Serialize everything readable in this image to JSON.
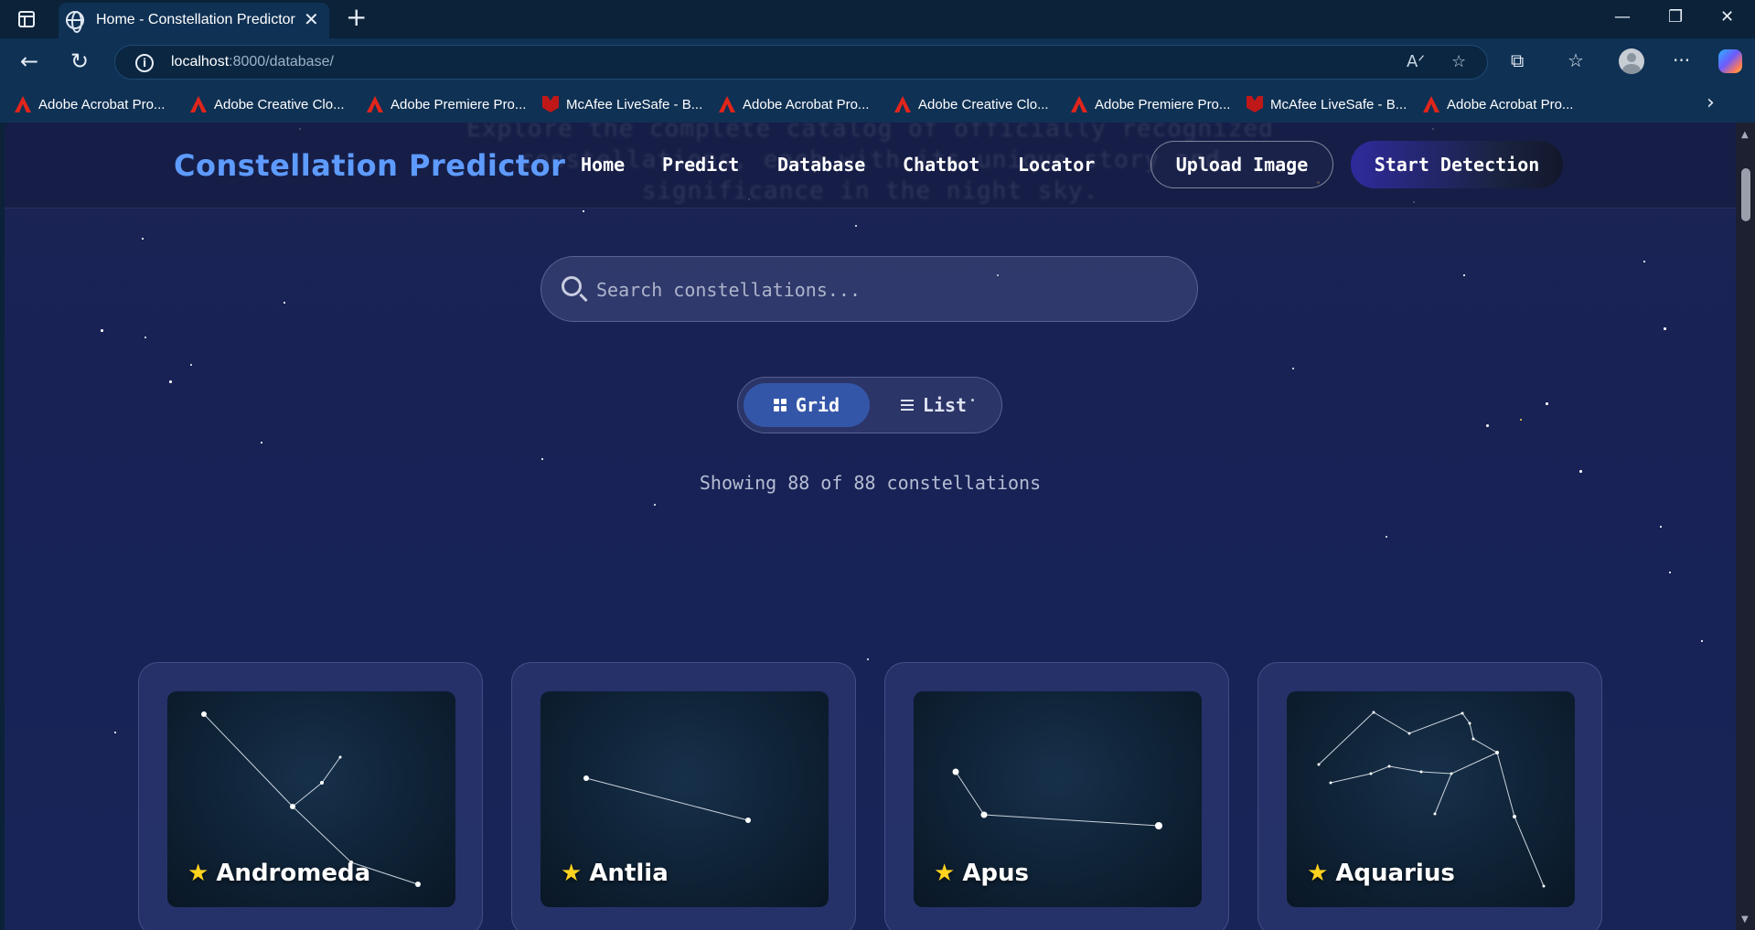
{
  "browser": {
    "tab_title": "Home - Constellation Predictor",
    "url_host": "localhost",
    "url_path": ":8000/database/",
    "bookmarks": [
      {
        "label": "Adobe Acrobat Pro...",
        "icon": "adobe"
      },
      {
        "label": "Adobe Creative Clo...",
        "icon": "adobe"
      },
      {
        "label": "Adobe Premiere Pro...",
        "icon": "adobe"
      },
      {
        "label": "McAfee LiveSafe - B...",
        "icon": "mcafee"
      },
      {
        "label": "Adobe Acrobat Pro...",
        "icon": "adobe"
      },
      {
        "label": "Adobe Creative Clo...",
        "icon": "adobe"
      },
      {
        "label": "Adobe Premiere Pro...",
        "icon": "adobe"
      },
      {
        "label": "McAfee LiveSafe - B...",
        "icon": "mcafee"
      },
      {
        "label": "Adobe Acrobat Pro...",
        "icon": "adobe"
      }
    ]
  },
  "page": {
    "ghost_lines": [
      "Explore the complete catalog of officially recognized",
      "constellations, each with its unique story and",
      "significance in the night sky."
    ],
    "logo": "Constellation Predictor",
    "nav": [
      "Home",
      "Predict",
      "Database",
      "Chatbot",
      "Locator"
    ],
    "upload_button": "Upload Image",
    "detect_button": "Start Detection",
    "search_placeholder": "Search constellations...",
    "view_toggle": {
      "grid": "Grid",
      "list": "List",
      "active": "grid"
    },
    "count_text": "Showing 88 of 88 constellations",
    "cards": [
      {
        "name": "Andromeda"
      },
      {
        "name": "Antlia"
      },
      {
        "name": "Apus"
      },
      {
        "name": "Aquarius"
      }
    ]
  },
  "colors": {
    "accent_logo": "#5e9bff",
    "toggle_active": "#3456a8",
    "badge_star": "#ffd21f"
  }
}
